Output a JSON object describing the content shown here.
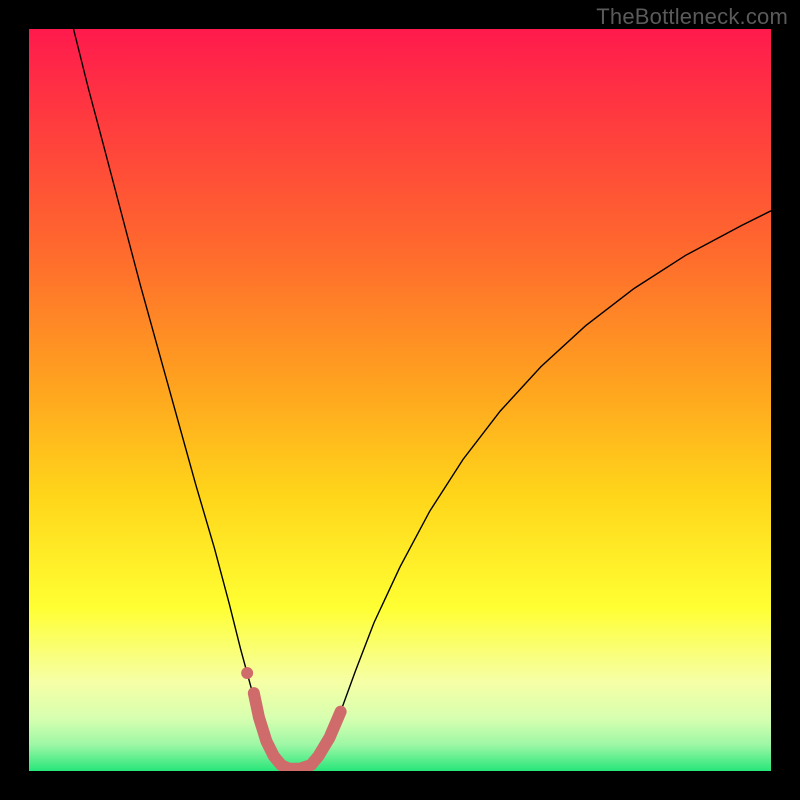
{
  "watermark": "TheBottleneck.com",
  "chart_data": {
    "type": "line",
    "title": "",
    "xlabel": "",
    "ylabel": "",
    "xlim": [
      0,
      100
    ],
    "ylim": [
      0,
      100
    ],
    "grid": false,
    "background": {
      "kind": "vertical-gradient",
      "stops": [
        {
          "offset": 0.0,
          "color": "#ff1a4d"
        },
        {
          "offset": 0.12,
          "color": "#ff3a3f"
        },
        {
          "offset": 0.3,
          "color": "#ff6a2d"
        },
        {
          "offset": 0.48,
          "color": "#ffa31f"
        },
        {
          "offset": 0.63,
          "color": "#ffd61a"
        },
        {
          "offset": 0.78,
          "color": "#ffff33"
        },
        {
          "offset": 0.88,
          "color": "#f6ffa6"
        },
        {
          "offset": 0.93,
          "color": "#d6ffb0"
        },
        {
          "offset": 0.965,
          "color": "#9cf7a5"
        },
        {
          "offset": 1.0,
          "color": "#28e67a"
        }
      ]
    },
    "series": [
      {
        "name": "bottleneck-curve",
        "stroke": "#000000",
        "stroke_width": 1.4,
        "points": [
          {
            "x": 6.0,
            "y": 100.0
          },
          {
            "x": 8.0,
            "y": 92.0
          },
          {
            "x": 10.0,
            "y": 84.5
          },
          {
            "x": 12.5,
            "y": 75.0
          },
          {
            "x": 15.0,
            "y": 65.5
          },
          {
            "x": 17.5,
            "y": 56.5
          },
          {
            "x": 20.0,
            "y": 47.5
          },
          {
            "x": 22.5,
            "y": 38.5
          },
          {
            "x": 25.0,
            "y": 30.0
          },
          {
            "x": 27.0,
            "y": 22.5
          },
          {
            "x": 28.5,
            "y": 16.5
          },
          {
            "x": 30.0,
            "y": 11.0
          },
          {
            "x": 31.0,
            "y": 7.0
          },
          {
            "x": 32.0,
            "y": 4.0
          },
          {
            "x": 33.0,
            "y": 2.0
          },
          {
            "x": 34.0,
            "y": 0.8
          },
          {
            "x": 35.0,
            "y": 0.3
          },
          {
            "x": 36.5,
            "y": 0.3
          },
          {
            "x": 38.0,
            "y": 0.8
          },
          {
            "x": 39.0,
            "y": 2.0
          },
          {
            "x": 40.5,
            "y": 4.5
          },
          {
            "x": 42.0,
            "y": 8.0
          },
          {
            "x": 44.0,
            "y": 13.5
          },
          {
            "x": 46.5,
            "y": 20.0
          },
          {
            "x": 50.0,
            "y": 27.5
          },
          {
            "x": 54.0,
            "y": 35.0
          },
          {
            "x": 58.5,
            "y": 42.0
          },
          {
            "x": 63.5,
            "y": 48.5
          },
          {
            "x": 69.0,
            "y": 54.5
          },
          {
            "x": 75.0,
            "y": 60.0
          },
          {
            "x": 81.5,
            "y": 65.0
          },
          {
            "x": 88.5,
            "y": 69.5
          },
          {
            "x": 96.0,
            "y": 73.5
          },
          {
            "x": 100.0,
            "y": 75.5
          }
        ]
      },
      {
        "name": "highlight-segment",
        "stroke": "#cf6b6b",
        "stroke_width": 12,
        "linecap": "round",
        "points": [
          {
            "x": 30.3,
            "y": 10.5
          },
          {
            "x": 31.0,
            "y": 7.2
          },
          {
            "x": 32.0,
            "y": 4.0
          },
          {
            "x": 33.0,
            "y": 2.0
          },
          {
            "x": 34.0,
            "y": 0.8
          },
          {
            "x": 35.0,
            "y": 0.3
          },
          {
            "x": 36.5,
            "y": 0.3
          },
          {
            "x": 38.0,
            "y": 0.8
          },
          {
            "x": 39.0,
            "y": 2.0
          },
          {
            "x": 40.5,
            "y": 4.5
          },
          {
            "x": 42.0,
            "y": 8.0
          }
        ]
      },
      {
        "name": "highlight-dot",
        "stroke": "#cf6b6b",
        "kind": "dot",
        "radius": 6,
        "points": [
          {
            "x": 29.4,
            "y": 13.2
          }
        ]
      }
    ]
  }
}
